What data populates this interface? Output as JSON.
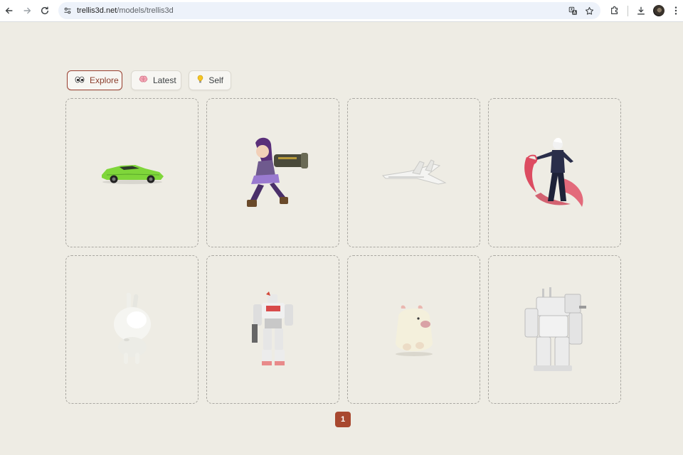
{
  "browser": {
    "url_host": "trellis3d.net",
    "url_path": "/models/trellis3d",
    "icons": [
      "back-arrow-icon",
      "forward-arrow-icon",
      "reload-icon",
      "site-info-icon",
      "translate-icon",
      "star-icon",
      "extensions-icon",
      "download-icon",
      "kebab-menu-icon"
    ]
  },
  "tabs": [
    {
      "icon": "eyes-icon",
      "label": "Explore",
      "active": true
    },
    {
      "icon": "brain-icon",
      "label": "Latest",
      "active": false
    },
    {
      "icon": "lightbulb-icon",
      "label": "Self",
      "active": false
    }
  ],
  "models": [
    {
      "subject": "green sports car"
    },
    {
      "subject": "purple-haired anime girl with cannon"
    },
    {
      "subject": "white jet aircraft"
    },
    {
      "subject": "white-haired fighter with red energy"
    },
    {
      "subject": "white bunny figure"
    },
    {
      "subject": "white and red mecha robot"
    },
    {
      "subject": "cream hamster figure"
    },
    {
      "subject": "white mech with antennas"
    }
  ],
  "pagination": {
    "current_page": "1"
  },
  "colors": {
    "page_bg": "#eeece4",
    "accent": "#a8482f",
    "active_tab_border": "#9a4030",
    "card_border": "#a9a7a1"
  }
}
